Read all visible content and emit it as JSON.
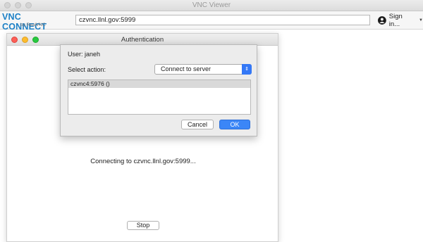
{
  "app_window": {
    "title": "VNC Viewer"
  },
  "toolbar": {
    "logo_text": "VNC CONNECT",
    "logo_subtext": "by RealVNC",
    "address_value": "czvnc.llnl.gov:5999",
    "signin_label": "Sign in...",
    "signin_icon": "person-icon",
    "dropdown_icon": "caret-down-icon"
  },
  "auth_window": {
    "title": "Authentication",
    "connecting_text": "Connecting to czvnc.llnl.gov:5999...",
    "stop_label": "Stop"
  },
  "auth_sheet": {
    "user_text": "User: janeh",
    "select_action_label": "Select action:",
    "selected_action": "Connect to server",
    "list_items": [
      "czvnc4:5976 ()"
    ],
    "cancel_label": "Cancel",
    "ok_label": "OK"
  },
  "colors": {
    "accent_blue": "#3478f6",
    "logo_blue": "#1c80c6",
    "close_red": "#fc5f57",
    "minimize_yellow": "#fdbc2e",
    "zoom_green": "#28c940"
  }
}
